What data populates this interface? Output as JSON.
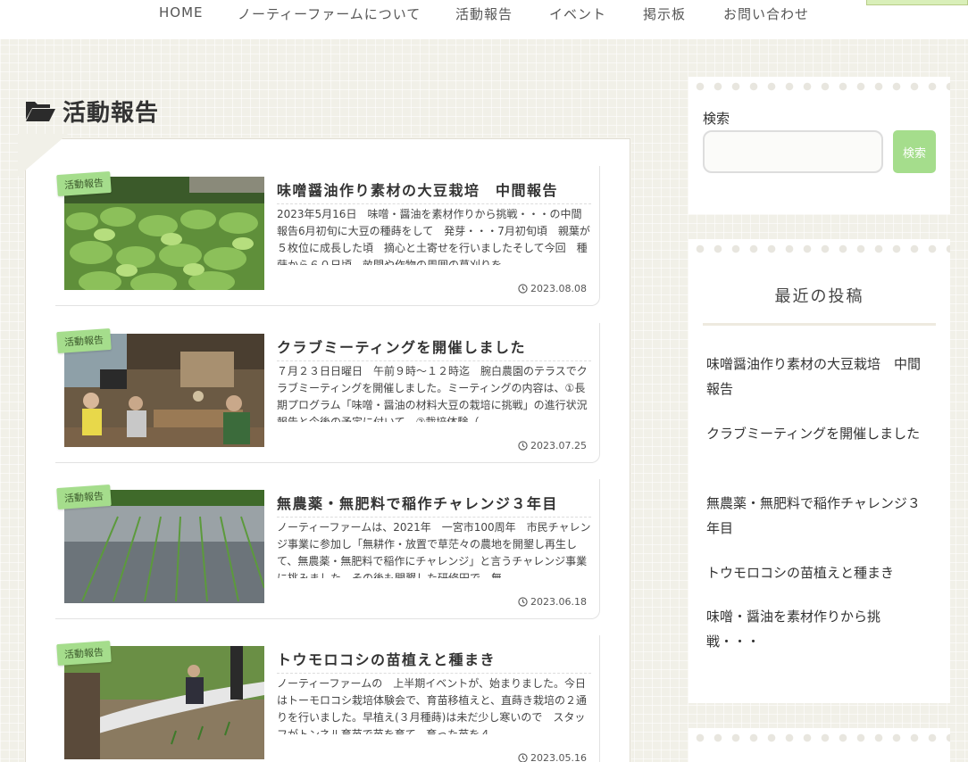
{
  "nav": {
    "items": [
      "HOME",
      "ノーティーファームについて",
      "活動報告",
      "イベント",
      "掲示板",
      "お問い合わせ"
    ]
  },
  "page": {
    "title": "活動報告",
    "icon": "folder-open-icon"
  },
  "posts": [
    {
      "category": "活動報告",
      "title": "味噌醤油作り素材の大豆栽培　中間報告",
      "excerpt": "2023年5月16日　味噌・醤油を素材作りから挑戦・・・の中間報告6月初旬に大豆の種蒔をして　発芽・・・7月初旬頃　親葉が５枚位に成長した頃　摘心と土寄せを行いましたそして今回　種蒔から６０日頃　畝間や作物の周囲の草刈りを…",
      "date": "2023.08.08",
      "thumb": "soybean-field"
    },
    {
      "category": "活動報告",
      "title": "クラブミーティングを開催しました",
      "excerpt": "７月２３日日曜日　午前９時～１２時迄　腕白農園のテラスでクラブミーティングを開催しました。ミーティングの内容は、①長期プログラム「味噌・醤油の材料大豆の栽培に挑戦」の進行状況報告と今後の予定に付いて　②栽培体験（…",
      "date": "2023.07.25",
      "thumb": "club-meeting"
    },
    {
      "category": "活動報告",
      "title": "無農薬・無肥料で稲作チャレンジ３年目",
      "excerpt": "ノーティーファームは、2021年　一宮市100周年　市民チャレンジ事業に参加し「無耕作・放置で草茫々の農地を開墾し再生して、無農薬・無肥料で稲作にチャレンジ」と言うチャレンジ事業に挑みました。その後も開墾した研修田で　無…",
      "date": "2023.06.18",
      "thumb": "rice-paddy"
    },
    {
      "category": "活動報告",
      "title": "トウモロコシの苗植えと種まき",
      "excerpt": "ノーティーファームの　上半期イベントが、始まりました。今日はトーモロコシ栽培体験会で、育苗移植えと、直蒔き栽培の２通りを行いました。早植え(３月種蒔)は未だ少し寒いので　スタッフがトンネル育苗で苗を育て、育った苗を４…",
      "date": "2023.05.16",
      "thumb": "corn-planting"
    }
  ],
  "sidebar": {
    "search_label": "検索",
    "search_value": "",
    "search_button": "検索",
    "recent_title": "最近の投稿",
    "recent": [
      "味噌醤油作り素材の大豆栽培　中間報告",
      "クラブミーティングを開催しました",
      "無農薬・無肥料で稲作チャレンジ３年目",
      "トウモロコシの苗植えと種まき",
      "味噌・醤油を素材作りから挑戦・・・"
    ]
  },
  "colors": {
    "accent": "#a5dd8c",
    "background": "#f1f0e8"
  }
}
